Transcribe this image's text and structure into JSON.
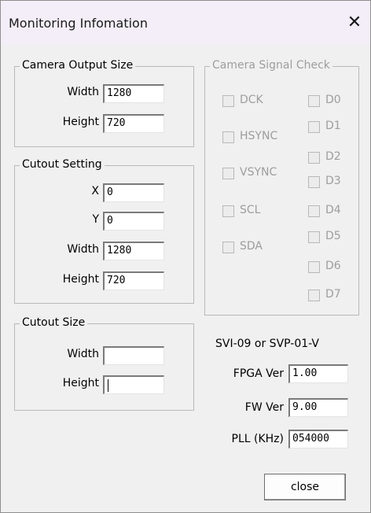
{
  "window": {
    "title": "Monitoring Infomation",
    "close_glyph": "✕"
  },
  "camera_output": {
    "legend": "Camera Output Size",
    "width_label": "Width",
    "width_value": "1280",
    "height_label": "Height",
    "height_value": "720"
  },
  "cutout_setting": {
    "legend": "Cutout Setting",
    "x_label": "X",
    "x_value": "0",
    "y_label": "Y",
    "y_value": "0",
    "width_label": "Width",
    "width_value": "1280",
    "height_label": "Height",
    "height_value": "720"
  },
  "cutout_size": {
    "legend": "Cutout Size",
    "width_label": "Width",
    "width_value": "",
    "height_label": "Height",
    "height_value": ""
  },
  "signal_check": {
    "legend": "Camera Signal Check",
    "left": [
      {
        "label": "DCK",
        "checked": false
      },
      {
        "label": "HSYNC",
        "checked": false
      },
      {
        "label": "VSYNC",
        "checked": false
      },
      {
        "label": "SCL",
        "checked": false
      },
      {
        "label": "SDA",
        "checked": false
      }
    ],
    "right": [
      {
        "label": "D0",
        "checked": false
      },
      {
        "label": "D1",
        "checked": false
      },
      {
        "label": "D2",
        "checked": false
      },
      {
        "label": "D3",
        "checked": false
      },
      {
        "label": "D4",
        "checked": false
      },
      {
        "label": "D5",
        "checked": false
      },
      {
        "label": "D6",
        "checked": false
      },
      {
        "label": "D7",
        "checked": false
      }
    ]
  },
  "device": {
    "model": "SVI-09 or SVP-01-V",
    "fpga_label": "FPGA Ver",
    "fpga_value": "1.00",
    "fw_label": "FW Ver",
    "fw_value": "9.00",
    "pll_label": "PLL (KHz)",
    "pll_value": "054000"
  },
  "buttons": {
    "close_label": "close"
  },
  "colors": {
    "title_bg": "#f3eef7",
    "dialog_bg": "#f0f0f0",
    "disabled_text": "#9d9d9d"
  }
}
